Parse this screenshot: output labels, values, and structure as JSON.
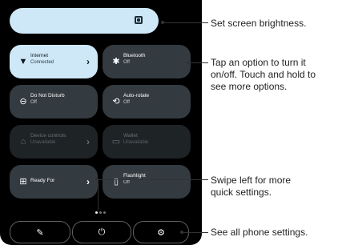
{
  "tiles": [
    {
      "label": "Internet",
      "state": "Connected",
      "icon": "▼",
      "chevron": "›"
    },
    {
      "label": "Bluetooth",
      "state": "Off",
      "icon": "✱"
    },
    {
      "label": "Do Not Disturb",
      "state": "Off",
      "icon": "⊖"
    },
    {
      "label": "Auto-rotate",
      "state": "Off",
      "icon": "⟲"
    },
    {
      "label": "Device controls",
      "state": "Unavailable",
      "icon": "⌂",
      "chevron": "›"
    },
    {
      "label": "Wallet",
      "state": "Unavailable",
      "icon": "▭"
    },
    {
      "label": "Ready For",
      "state": "",
      "icon": "⊞",
      "chevron": "›"
    },
    {
      "label": "Flashlight",
      "state": "Off",
      "icon": "▯"
    }
  ],
  "buttons": {
    "edit_icon": "✎",
    "power_icon": "⏻",
    "settings_icon": "⚙"
  },
  "annotations": {
    "brightness": "Set screen brightness.",
    "tap_line1": "Tap an option to turn it",
    "tap_line2": "on/off. Touch and hold to",
    "tap_line3": "see more options.",
    "swipe_line1": "Swipe left for more",
    "swipe_line2": "quick settings.",
    "settings": "See all phone settings."
  },
  "colors": {
    "accent": "#cfe8f7",
    "tile": "#333a40",
    "background": "#000000"
  }
}
